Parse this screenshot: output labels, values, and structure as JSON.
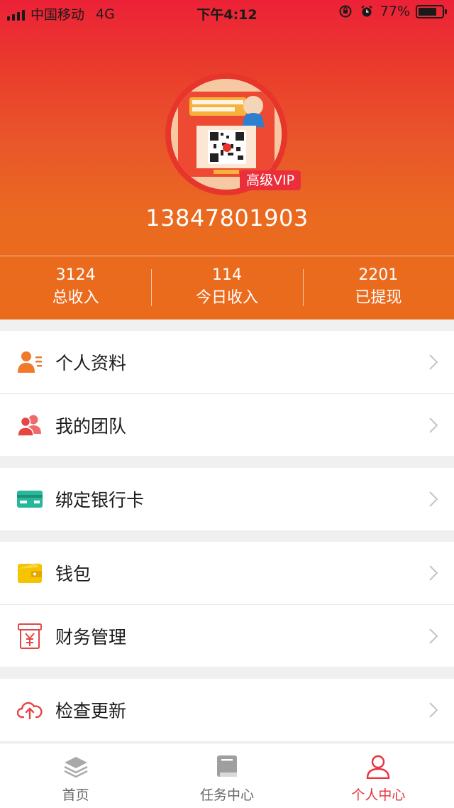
{
  "status_bar": {
    "carrier": "中国移动",
    "network": "4G",
    "time": "下午4:12",
    "battery": "77%",
    "battery_level": 0.77
  },
  "profile": {
    "vip_badge": "高级VIP",
    "phone": "13847801903",
    "avatar_icon": "qr-poster-avatar"
  },
  "stats": [
    {
      "value": "3124",
      "label": "总收入"
    },
    {
      "value": "114",
      "label": "今日收入"
    },
    {
      "value": "2201",
      "label": "已提现"
    }
  ],
  "menu": {
    "profile": "个人资料",
    "team": "我的团队",
    "bank_card": "绑定银行卡",
    "wallet": "钱包",
    "finance": "财务管理",
    "update": "检查更新"
  },
  "tabs": [
    {
      "label": "首页",
      "icon": "layers-icon"
    },
    {
      "label": "任务中心",
      "icon": "book-icon"
    },
    {
      "label": "个人中心",
      "icon": "person-icon"
    }
  ],
  "colors": {
    "accent": "#e8323e",
    "header_top": "#ec2137",
    "header_bottom": "#eb6b1c"
  }
}
